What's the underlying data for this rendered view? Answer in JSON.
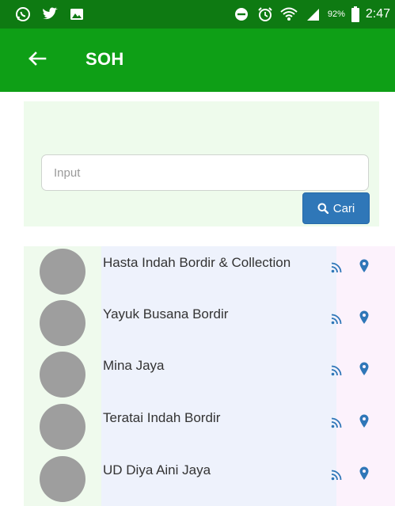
{
  "status_bar": {
    "battery": "92%",
    "time": "2:47",
    "left_icons": [
      "whatsapp-icon",
      "twitter-icon",
      "image-icon"
    ],
    "right_icons": [
      "do-not-disturb-icon",
      "alarm-icon",
      "wifi-icon",
      "signal-icon",
      "battery-icon"
    ]
  },
  "app_bar": {
    "title": "SOH",
    "back_icon": "arrow-left-icon",
    "color": "#0e9f16"
  },
  "search": {
    "placeholder": "Input",
    "value": "",
    "button_label": "Cari",
    "button_icon": "search-icon",
    "button_color": "#2f77b8"
  },
  "stores": [
    {
      "name": "Hasta Indah Bordir & Collection"
    },
    {
      "name": "Yayuk Busana Bordir"
    },
    {
      "name": "Mina Jaya"
    },
    {
      "name": "Teratai Indah Bordir"
    },
    {
      "name": "UD Diya Aini Jaya"
    }
  ],
  "row_icons": [
    "rss-icon",
    "map-pin-icon"
  ],
  "accent_color": "#2f77b8"
}
